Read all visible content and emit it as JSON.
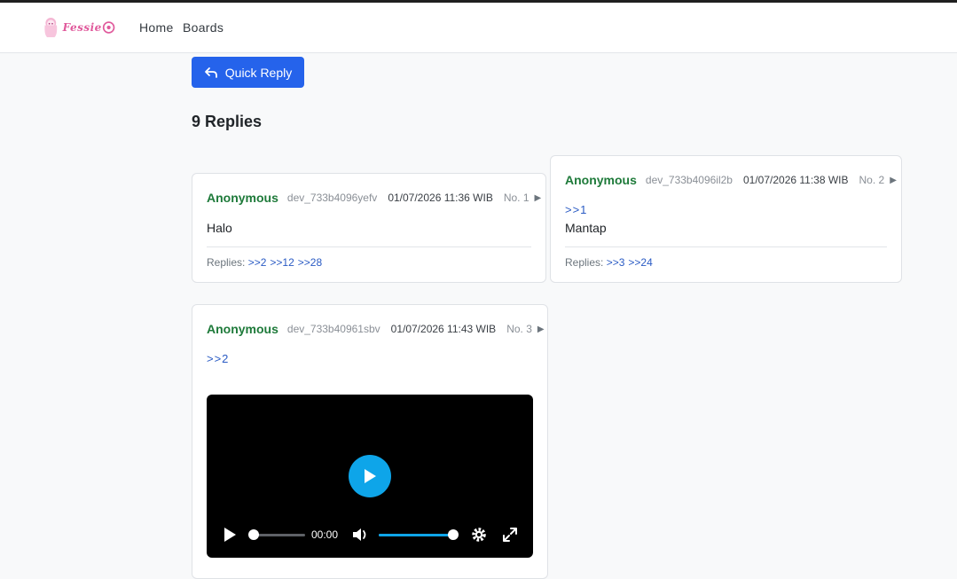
{
  "navbar": {
    "logo_text": "Fessie",
    "links": [
      "Home",
      "Boards"
    ]
  },
  "quick_reply": {
    "label": "Quick Reply"
  },
  "replies_title": "9 Replies",
  "posts": [
    {
      "name": "Anonymous",
      "uid": "dev_733b4096yefv",
      "date": "01/07/2026 11:36 WIB",
      "no": "No. 1",
      "toggle": "▶",
      "message": "Halo",
      "replies_label": "Replies:",
      "replies": [
        ">>2",
        ">>12",
        ">>28"
      ]
    },
    {
      "name": "Anonymous",
      "uid": "dev_733b4096il2b",
      "date": "01/07/2026 11:38 WIB",
      "no": "No. 2",
      "toggle": "▶",
      "quote": ">>1",
      "message": "Mantap",
      "replies_label": "Replies:",
      "replies": [
        ">>3",
        ">>24"
      ]
    },
    {
      "name": "Anonymous",
      "uid": "dev_733b40961sbv",
      "date": "01/07/2026 11:43 WIB",
      "no": "No. 3",
      "toggle": "▶",
      "quote": ">>2",
      "video": {
        "time": "00:00",
        "progress": 0,
        "volume": 1.0
      }
    }
  ],
  "colors": {
    "accent": "#2563eb",
    "name": "#1e7a3a",
    "link": "#2a5bc4",
    "play": "#0ea5e9"
  }
}
